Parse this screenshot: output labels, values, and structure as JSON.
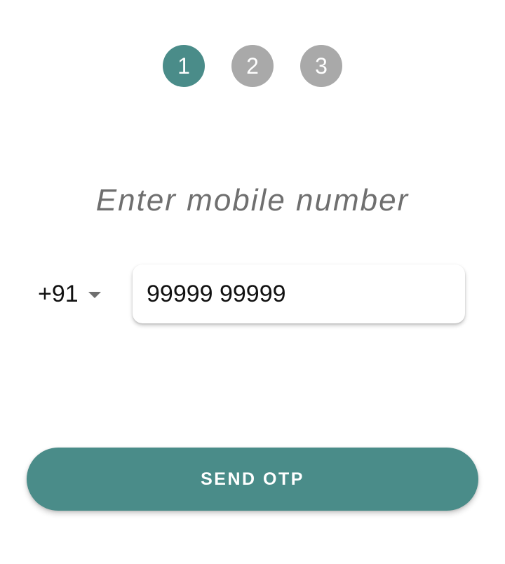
{
  "colors": {
    "accent": "#4a8c89",
    "step_inactive": "#a9a9a9",
    "heading_text": "#6f6f6f"
  },
  "stepper": {
    "steps": [
      {
        "label": "1",
        "state": "active"
      },
      {
        "label": "2",
        "state": "inactive"
      },
      {
        "label": "3",
        "state": "inactive"
      }
    ]
  },
  "heading": "Enter mobile number",
  "country_selector": {
    "value": "+91",
    "icon": "caret-down-icon"
  },
  "phone_input": {
    "value": "99999 99999"
  },
  "send_button": {
    "label": "SEND OTP"
  }
}
